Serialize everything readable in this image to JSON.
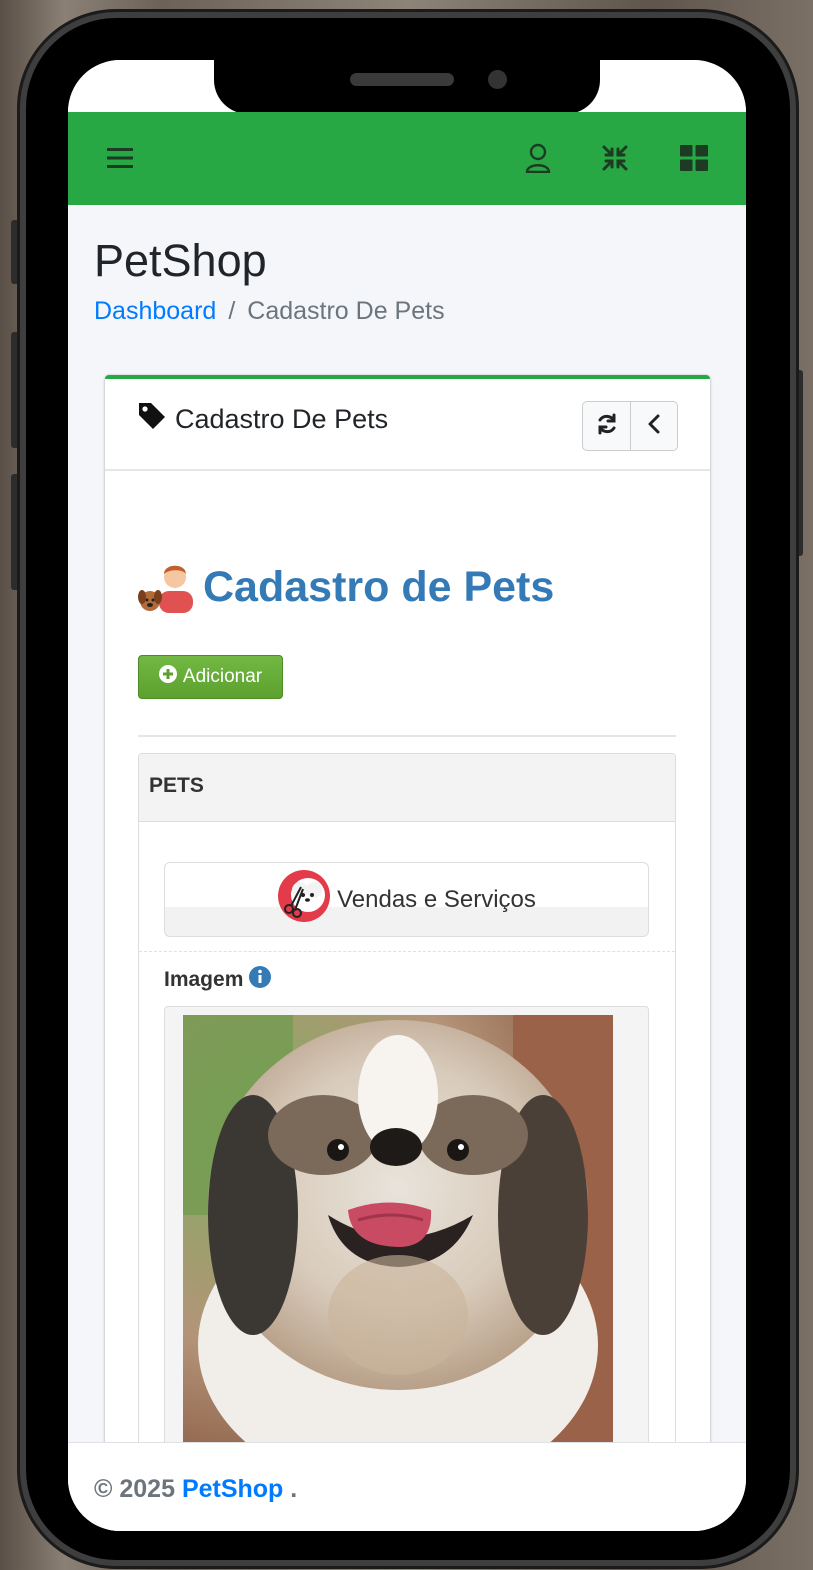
{
  "navbar": {
    "menu_icon": "hamburger-icon",
    "user_icon": "user-icon",
    "collapse_icon": "compress-icon",
    "apps_icon": "grid-icon",
    "color": "#28a745"
  },
  "page": {
    "title": "PetShop",
    "breadcrumb": {
      "home": "Dashboard",
      "separator": "/",
      "current": "Cadastro De Pets"
    }
  },
  "card": {
    "title": "Cadastro De Pets",
    "title_icon": "tag-icon",
    "refresh_icon": "refresh-icon",
    "back_icon": "chevron-left-icon"
  },
  "form": {
    "heading": "Cadastro de Pets",
    "add_button": "Adicionar",
    "panel_heading": "PETS",
    "sales_button": "Vendas e Serviços",
    "image_label": "Imagem"
  },
  "footer": {
    "copyright": "© 2025",
    "brand": "PetShop",
    "suffix": "."
  }
}
